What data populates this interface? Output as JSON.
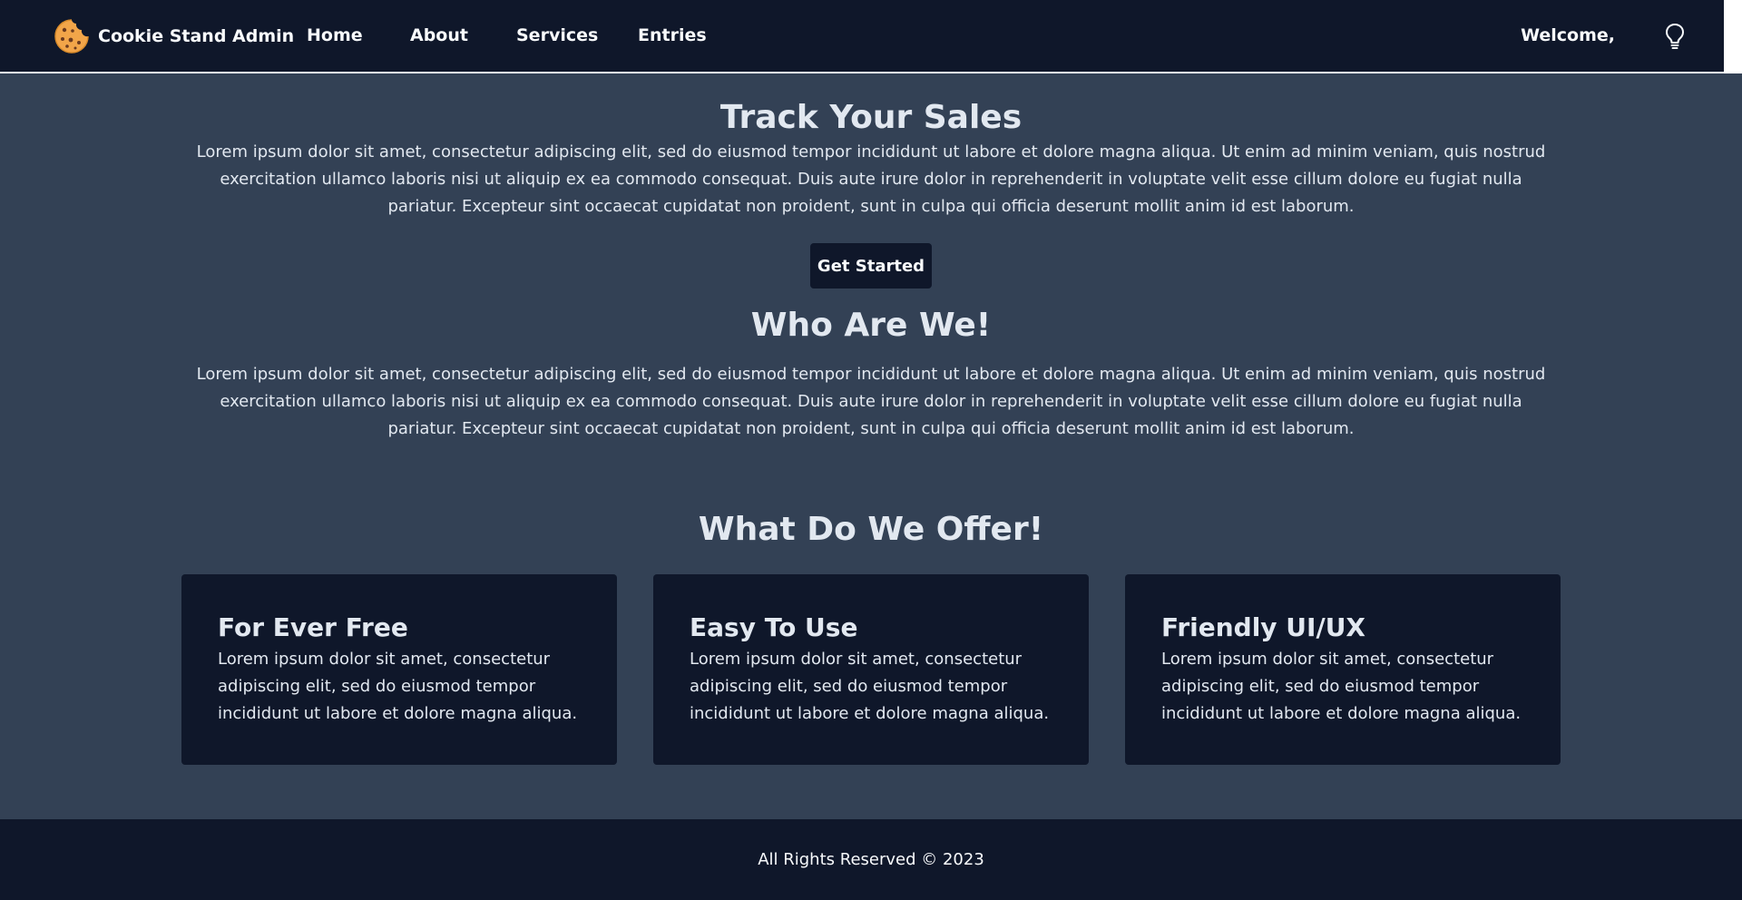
{
  "nav": {
    "brand": "Cookie Stand Admin",
    "brand_icon": "cookie-icon",
    "links": [
      "Home",
      "About",
      "Services",
      "Entries"
    ],
    "welcome": "Welcome,",
    "theme_icon": "lightbulb-icon"
  },
  "hero": {
    "title": "Track Your Sales",
    "text": "Lorem ipsum dolor sit amet, consectetur adipiscing elit, sed do eiusmod tempor incididunt ut labore et dolore magna aliqua. Ut enim ad minim veniam, quis nostrud exercitation ullamco laboris nisi ut aliquip ex ea commodo consequat. Duis aute irure dolor in reprehenderit in voluptate velit esse cillum dolore eu fugiat nulla pariatur. Excepteur sint occaecat cupidatat non proident, sunt in culpa qui officia deserunt mollit anim id est laborum.",
    "button": "Get Started"
  },
  "about": {
    "title": "Who Are We!",
    "text": "Lorem ipsum dolor sit amet, consectetur adipiscing elit, sed do eiusmod tempor incididunt ut labore et dolore magna aliqua. Ut enim ad minim veniam, quis nostrud exercitation ullamco laboris nisi ut aliquip ex ea commodo consequat. Duis aute irure dolor in reprehenderit in voluptate velit esse cillum dolore eu fugiat nulla pariatur. Excepteur sint occaecat cupidatat non proident, sunt in culpa qui officia deserunt mollit anim id est laborum."
  },
  "offer": {
    "title": "What Do We Offer!",
    "cards": [
      {
        "title": "For Ever Free",
        "text": "Lorem ipsum dolor sit amet, consectetur adipiscing elit, sed do eiusmod tempor incididunt ut labore et dolore magna aliqua."
      },
      {
        "title": "Easy To Use",
        "text": "Lorem ipsum dolor sit amet, consectetur adipiscing elit, sed do eiusmod tempor incididunt ut labore et dolore magna aliqua."
      },
      {
        "title": "Friendly UI/UX",
        "text": "Lorem ipsum dolor sit amet, consectetur adipiscing elit, sed do eiusmod tempor incididunt ut labore et dolore magna aliqua."
      }
    ]
  },
  "footer": {
    "text": "All Rights Reserved © 2023"
  },
  "colors": {
    "page_bg": "#334155",
    "nav_bg": "#0f172a",
    "card_bg": "#0f172a",
    "text": "#e2e8f0",
    "cookie": "#f2a549"
  }
}
